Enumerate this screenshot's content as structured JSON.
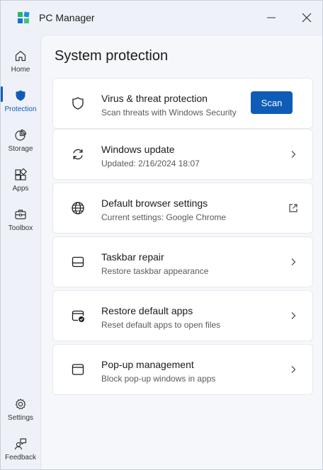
{
  "window": {
    "title": "PC Manager"
  },
  "sidebar": {
    "items": [
      {
        "label": "Home",
        "icon": "home-icon"
      },
      {
        "label": "Protection",
        "icon": "shield-icon",
        "active": true
      },
      {
        "label": "Storage",
        "icon": "pie-chart-icon"
      },
      {
        "label": "Apps",
        "icon": "apps-grid-icon"
      },
      {
        "label": "Toolbox",
        "icon": "toolbox-icon"
      }
    ],
    "bottom_items": [
      {
        "label": "Settings",
        "icon": "gear-icon"
      },
      {
        "label": "Feedback",
        "icon": "feedback-icon"
      }
    ]
  },
  "page": {
    "title": "System protection"
  },
  "cards": [
    {
      "title": "Virus & threat protection",
      "subtitle": "Scan threats with Windows Security",
      "action_label": "Scan",
      "icon": "shield-outline-icon"
    },
    {
      "title": "Windows update",
      "subtitle": "Updated: 2/16/2024 18:07",
      "icon": "sync-icon"
    },
    {
      "title": "Default browser settings",
      "subtitle": "Current settings: Google Chrome",
      "icon": "globe-icon"
    },
    {
      "title": "Taskbar repair",
      "subtitle": "Restore taskbar appearance",
      "icon": "taskbar-icon"
    },
    {
      "title": "Restore default apps",
      "subtitle": "Reset default apps to open files",
      "icon": "app-window-check-icon"
    },
    {
      "title": "Pop-up management",
      "subtitle": "Block pop-up windows in apps",
      "icon": "popup-window-icon"
    }
  ],
  "colors": {
    "accent": "#0f5cb8",
    "background": "#eef2f8",
    "card": "#ffffff"
  }
}
